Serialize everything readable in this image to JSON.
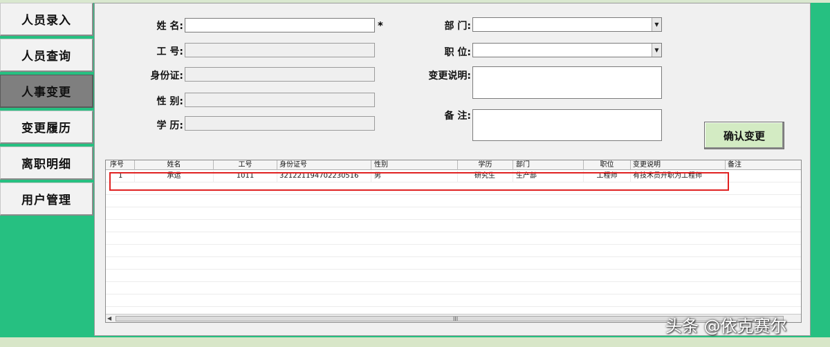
{
  "nav": {
    "items": [
      {
        "label": "人员录入"
      },
      {
        "label": "人员查询"
      },
      {
        "label": "人事变更"
      },
      {
        "label": "变更履历"
      },
      {
        "label": "离职明细"
      },
      {
        "label": "用户管理"
      }
    ],
    "active_index": 2
  },
  "form": {
    "name_label": "姓 名:",
    "name_value": "",
    "required_mark": "*",
    "id_label": "工 号:",
    "id_value": "",
    "idcard_label": "身份证:",
    "idcard_value": "",
    "gender_label": "性 别:",
    "gender_value": "",
    "education_label": "学 历:",
    "education_value": "",
    "dept_label": "部 门:",
    "dept_value": "",
    "position_label": "职 位:",
    "position_value": "",
    "change_desc_label": "变更说明:",
    "change_desc_value": "",
    "remark_label": "备 注:",
    "remark_value": "",
    "confirm_label": "确认变更"
  },
  "grid": {
    "columns": [
      "序号",
      "姓名",
      "工号",
      "身份证号",
      "性别",
      "学历",
      "部门",
      "职位",
      "变更说明",
      "备注"
    ],
    "rows": [
      [
        "1",
        "承运",
        "1011",
        "321221194702230516",
        "男",
        "研究生",
        "生产部",
        "工程师",
        "有技术员升职为工程师",
        ""
      ]
    ],
    "scroll_grip": "III"
  },
  "watermark": "头条 @依克赛尔",
  "colors": {
    "background": "#26c081",
    "panel": "#f0f0f0",
    "confirm_button": "#d3ebc3",
    "highlight": "#e02020",
    "active_nav": "#7f7f7f"
  }
}
